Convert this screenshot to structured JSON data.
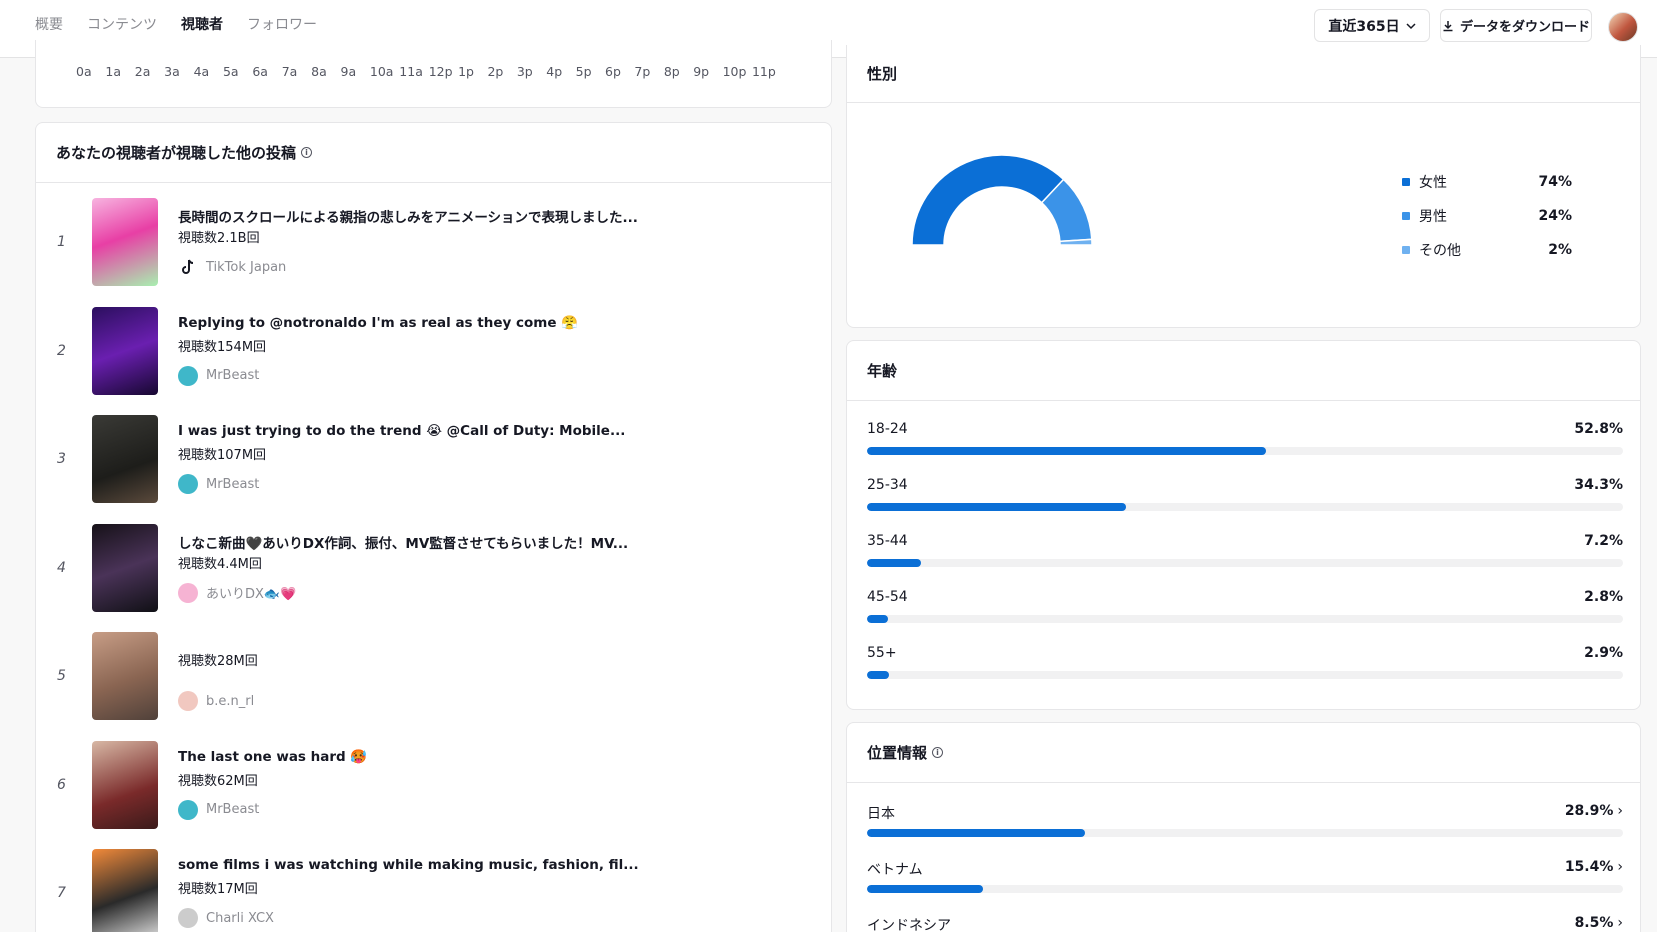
{
  "tabs": [
    "概要",
    "コンテンツ",
    "視聴者",
    "フォロワー"
  ],
  "active_tab_index": 2,
  "header": {
    "range_label": "直近365日",
    "download_label": "データをダウンロード"
  },
  "hours": [
    "0a",
    "1a",
    "2a",
    "3a",
    "4a",
    "5a",
    "6a",
    "7a",
    "8a",
    "9a",
    "10a",
    "11a",
    "12p",
    "1p",
    "2p",
    "3p",
    "4p",
    "5p",
    "6p",
    "7p",
    "8p",
    "9p",
    "10p",
    "11p"
  ],
  "posts_section": {
    "title": "あなたの視聴者が視聴した他の投稿",
    "items": [
      {
        "rank": "1",
        "title": "長時間のスクロールによる親指の悲しみをアニメーションで表現しました...",
        "views": "視聴数2.1B回",
        "author": "TikTok Japan"
      },
      {
        "rank": "2",
        "title": "Replying to @notronaldo I'm as real as they come 😤",
        "views": "視聴数154M回",
        "author": "MrBeast"
      },
      {
        "rank": "3",
        "title": "I was just trying to do the trend 😭 @Call of Duty: Mobile...",
        "views": "視聴数107M回",
        "author": "MrBeast"
      },
      {
        "rank": "4",
        "title": "しなこ新曲🖤あいりDX作詞、振付、MV監督させてもらいました！MV...",
        "views": "視聴数4.4M回",
        "author": "あいりDX🐟💗"
      },
      {
        "rank": "5",
        "title": "",
        "views": "視聴数28M回",
        "author": "b.e.n_rl"
      },
      {
        "rank": "6",
        "title": "The last one was hard 🥵",
        "views": "視聴数62M回",
        "author": "MrBeast"
      },
      {
        "rank": "7",
        "title": "some films i was watching while making music, fashion, fil...",
        "views": "視聴数17M回",
        "author": "Charli XCX"
      }
    ]
  },
  "gender": {
    "title": "性別",
    "items": [
      {
        "label": "女性",
        "value": "74%",
        "pct": 74,
        "color": "#0b6fd6"
      },
      {
        "label": "男性",
        "value": "24%",
        "pct": 24,
        "color": "#3b93e8"
      },
      {
        "label": "その他",
        "value": "2%",
        "pct": 2,
        "color": "#6fb1f0"
      }
    ]
  },
  "age": {
    "title": "年齢",
    "items": [
      {
        "label": "18-24",
        "value": "52.8%",
        "pct": 52.8
      },
      {
        "label": "25-34",
        "value": "34.3%",
        "pct": 34.3
      },
      {
        "label": "35-44",
        "value": "7.2%",
        "pct": 7.2
      },
      {
        "label": "45-54",
        "value": "2.8%",
        "pct": 2.8
      },
      {
        "label": "55+",
        "value": "2.9%",
        "pct": 2.9
      }
    ]
  },
  "location": {
    "title": "位置情報",
    "items": [
      {
        "label": "日本",
        "value": "28.9%",
        "pct": 28.9
      },
      {
        "label": "ベトナム",
        "value": "15.4%",
        "pct": 15.4
      },
      {
        "label": "インドネシア",
        "value": "8.5%",
        "pct": 8.5
      }
    ]
  }
}
